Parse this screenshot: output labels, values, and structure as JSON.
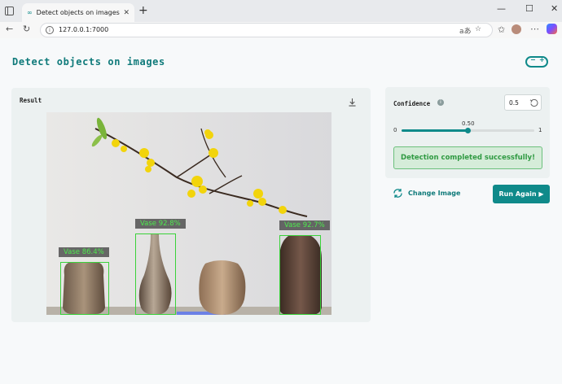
{
  "browser": {
    "tab_title": "Detect objects on images",
    "tab_favicon": "∞",
    "url": "127.0.0.1:7000"
  },
  "page": {
    "title": "Detect objects on images",
    "logo_icon": "arduino-logo-icon"
  },
  "result": {
    "label": "Result",
    "detections": [
      {
        "label": "Vase 86.4%",
        "class": "Vase",
        "confidence": 0.864
      },
      {
        "label": "Vase 92.8%",
        "class": "Vase",
        "confidence": 0.928
      },
      {
        "label": "Vase 92.7%",
        "class": "Vase",
        "confidence": 0.927
      }
    ]
  },
  "settings": {
    "confidence_label": "Confidence",
    "confidence_value": "0.5",
    "slider_value_label": "0.50",
    "slider_value": 0.5,
    "slider_min": "0",
    "slider_max": "1",
    "status_message": "Detection completed successfully!"
  },
  "actions": {
    "change_image": "Change Image",
    "run_again": "Run Again ▶"
  },
  "colors": {
    "accent": "#0f8a8a",
    "success_bg": "#d5ecd9",
    "success_text": "#2f9a42",
    "detection_box": "#3ad23a"
  }
}
